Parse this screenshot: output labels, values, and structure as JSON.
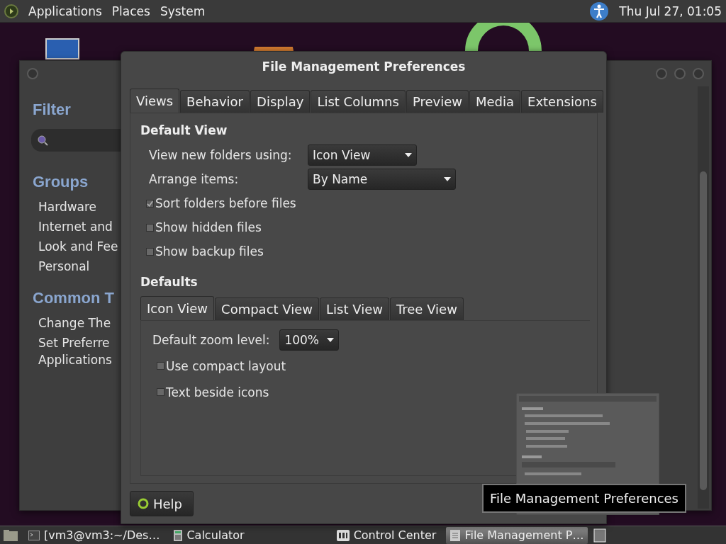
{
  "top_panel": {
    "menus": [
      "Applications",
      "Places",
      "System"
    ],
    "clock": "Thu Jul 27, 01:05"
  },
  "control_center": {
    "filter_title": "Filter",
    "groups_title": "Groups",
    "groups": [
      "Hardware",
      "Internet and",
      "Look and Fee",
      "Personal"
    ],
    "tasks_title": "Common T",
    "tasks": [
      "Change The",
      "Set Preferre",
      "Applications"
    ]
  },
  "dialog": {
    "title": "File Management Preferences",
    "tabs": [
      {
        "label": "Views",
        "selected": true
      },
      {
        "label": "Behavior",
        "selected": false
      },
      {
        "label": "Display",
        "selected": false
      },
      {
        "label": "List Columns",
        "selected": false
      },
      {
        "label": "Preview",
        "selected": false
      },
      {
        "label": "Media",
        "selected": false
      },
      {
        "label": "Extensions",
        "selected": false
      }
    ],
    "default_view": {
      "heading": "Default View",
      "dropdowns": [
        {
          "label": "View new folders using:",
          "value": "Icon View"
        },
        {
          "label": "Arrange items:",
          "value": "By Name"
        }
      ],
      "checks": [
        {
          "label": "Sort folders before files",
          "checked": true
        },
        {
          "label": "Show hidden files",
          "checked": false
        },
        {
          "label": "Show backup files",
          "checked": false
        }
      ]
    },
    "defaults": {
      "heading": "Defaults",
      "tabs": [
        {
          "label": "Icon View",
          "selected": true
        },
        {
          "label": "Compact View",
          "selected": false
        },
        {
          "label": "List View",
          "selected": false
        },
        {
          "label": "Tree View",
          "selected": false
        }
      ],
      "zoom": {
        "label": "Default zoom level:",
        "value": "100%"
      },
      "checks": [
        {
          "label": "Use compact layout",
          "checked": false
        },
        {
          "label": "Text beside icons",
          "checked": false
        }
      ]
    },
    "help_button": "Help"
  },
  "tooltip": "File Management Preferences",
  "taskbar": [
    {
      "label": "[vm3@vm3:~/Des…",
      "selected": false,
      "kind": "terminal"
    },
    {
      "label": "Calculator",
      "selected": false,
      "kind": "calculator"
    },
    {
      "label": "Control Center",
      "selected": false,
      "kind": "control"
    },
    {
      "label": "File Management P…",
      "selected": true,
      "kind": "document"
    }
  ]
}
